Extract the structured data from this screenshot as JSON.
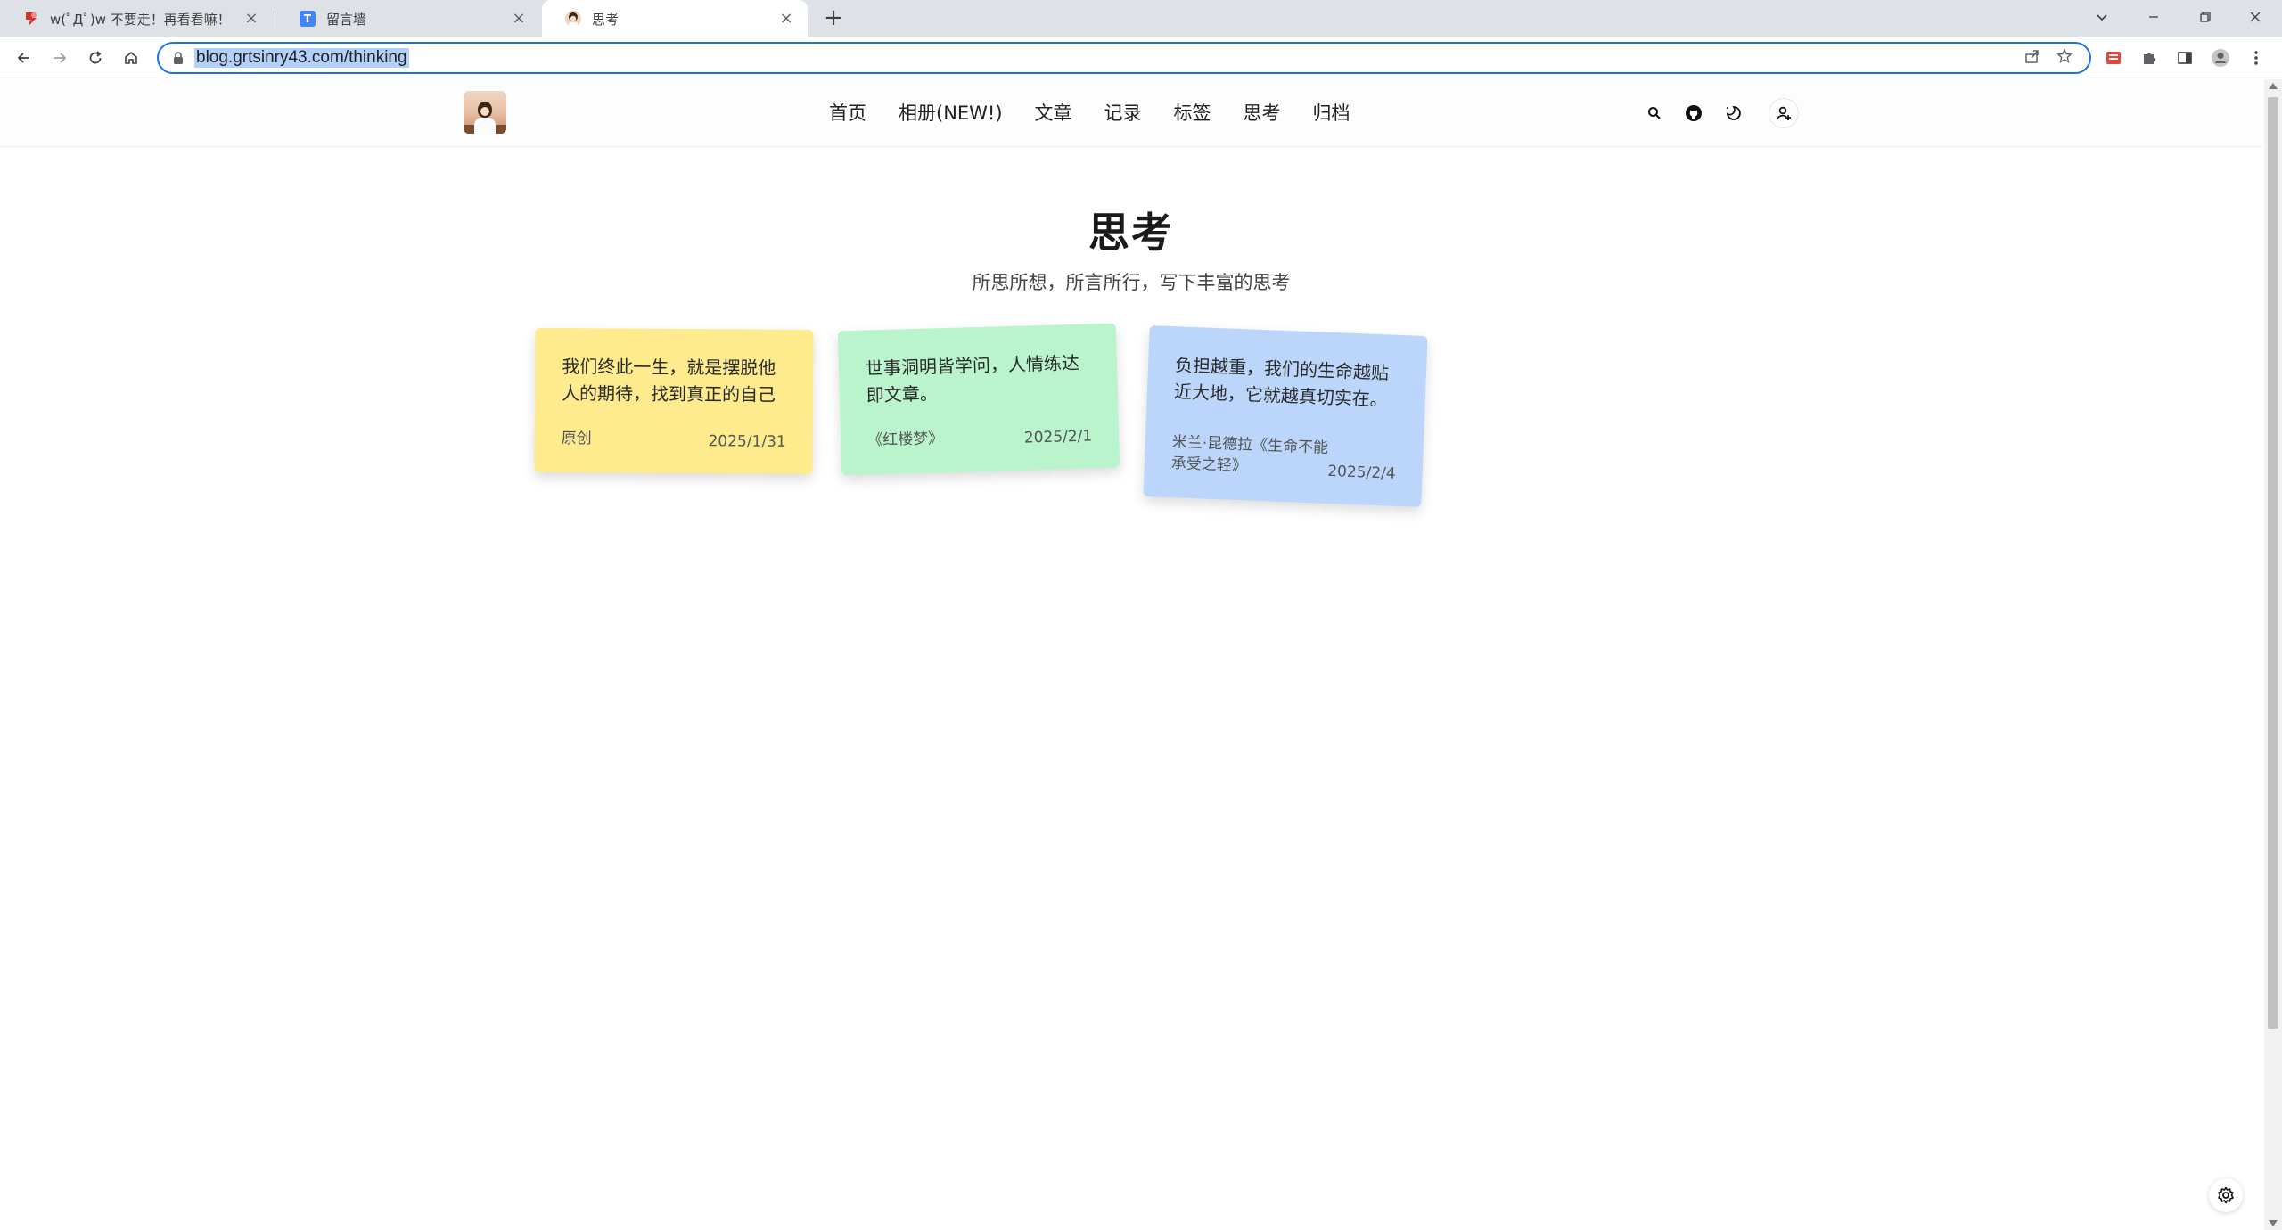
{
  "browser": {
    "tabs": [
      {
        "title": "w(ﾟДﾟ)w 不要走！再看看嘛！",
        "favicon_color": "#d93025"
      },
      {
        "title": "留言墙",
        "favicon_color": "#4285f4",
        "favicon_letter": "T"
      },
      {
        "title": "思考",
        "favicon_color": "#5a3a2a"
      }
    ],
    "active_tab": 2,
    "url": "blog.grtsinry43.com/thinking",
    "icons": [
      "back-icon",
      "forward-icon",
      "reload-icon",
      "home-icon",
      "lock-icon",
      "share-icon",
      "star-icon",
      "extension-icon",
      "puzzle-icon",
      "side-panel-icon",
      "profile-icon",
      "menu-icon"
    ]
  },
  "header": {
    "nav": [
      "首页",
      "相册(NEW!)",
      "文章",
      "记录",
      "标签",
      "思考",
      "归档"
    ],
    "icons": [
      "search-icon",
      "github-icon",
      "theme-toggle-icon",
      "user-icon"
    ]
  },
  "main": {
    "title": "思考",
    "subtitle": "所思所想，所言所行，写下丰富的思考",
    "notes": [
      {
        "text": "我们终此一生，就是摆脱他人的期待，找到真正的自己",
        "source": "原创",
        "date": "2025/1/31",
        "color": "#fdeb8e"
      },
      {
        "text": "世事洞明皆学问，人情练达即文章。",
        "source": "《红楼梦》",
        "date": "2025/2/1",
        "color": "#b9f4cc"
      },
      {
        "text": "负担越重，我们的生命越贴近大地，它就越真切实在。",
        "source": "米兰·昆德拉《生命不能承受之轻》",
        "date": "2025/2/4",
        "color": "#bcd6fb"
      }
    ]
  },
  "floating": {
    "settings_icon": "gear-icon"
  }
}
